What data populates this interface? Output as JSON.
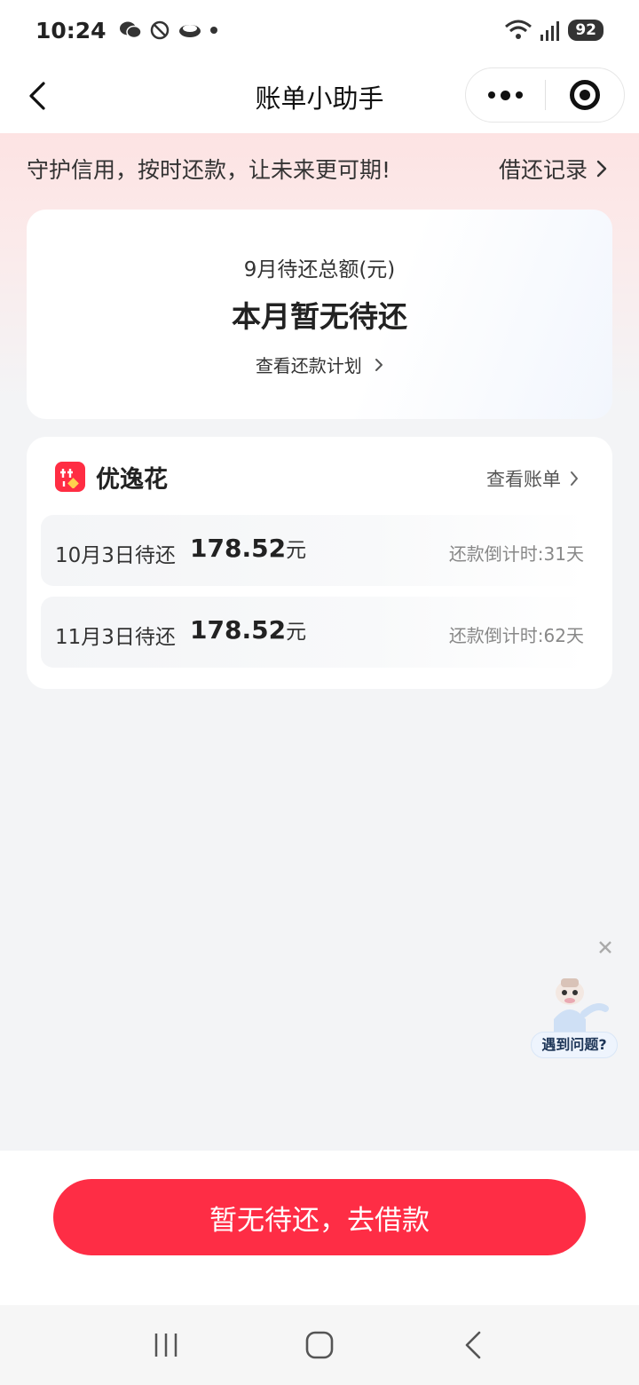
{
  "status_bar": {
    "time": "10:24",
    "battery": "92"
  },
  "nav": {
    "title": "账单小助手"
  },
  "banner": {
    "slogan": "守护信用，按时还款，让未来更可期!",
    "records_link": "借还记录"
  },
  "summary": {
    "label": "9月待还总额(元)",
    "value": "本月暂无待还",
    "plan_link": "查看还款计划"
  },
  "product": {
    "name": "优逸花",
    "view_bill": "查看账单",
    "bills": [
      {
        "date": "10月3日待还",
        "amount": "178.52",
        "unit": "元",
        "countdown": "还款倒计时:31天"
      },
      {
        "date": "11月3日待还",
        "amount": "178.52",
        "unit": "元",
        "countdown": "还款倒计时:62天"
      }
    ]
  },
  "helper": {
    "label": "遇到问题?"
  },
  "action": {
    "button_label": "暂无待还，去借款"
  },
  "colors": {
    "accent": "#fe2d45",
    "background": "#f3f4f6"
  }
}
